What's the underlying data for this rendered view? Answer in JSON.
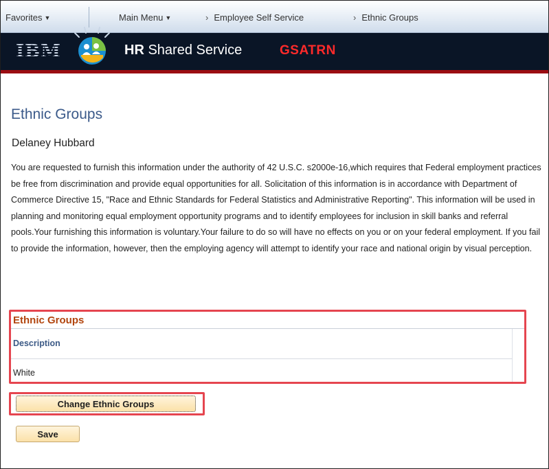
{
  "nav": {
    "favorites": "Favorites",
    "main_menu": "Main Menu",
    "crumb1": "Employee Self Service",
    "crumb2": "Ethnic Groups"
  },
  "banner": {
    "logo_text": "IBM",
    "brand_bold": "HR",
    "brand_rest": " Shared Service",
    "database": "GSATRN"
  },
  "page": {
    "title": "Ethnic Groups",
    "employee_name": "Delaney Hubbard",
    "notice": "You are requested to furnish this information under the authority of 42 U.S.C. s2000e-16,which requires that Federal employment practices be free from discrimination and provide equal opportunities for all.  Solicitation of this information is in accordance with Department of Commerce Directive 15, \"Race and Ethnic Standards for Federal Statistics and Administrative Reporting\". This information will be used in planning and monitoring equal employment opportunity programs and to identify employees for inclusion in skill banks and referral pools.Your furnishing this information is voluntary.Your failure to do so will have no effects on you or on your federal employment. If you fail to provide the information, however, then the employing agency will attempt to identify your race and national origin by visual perception."
  },
  "grid": {
    "title": "Ethnic Groups",
    "column_header": "Description",
    "rows": [
      "White"
    ]
  },
  "buttons": {
    "change": "Change Ethnic Groups",
    "save": "Save"
  },
  "colors": {
    "highlight": "#e5454f",
    "title_blue": "#3b5a8a",
    "grid_title": "#b2450e",
    "database_red": "#ff2a2a"
  }
}
